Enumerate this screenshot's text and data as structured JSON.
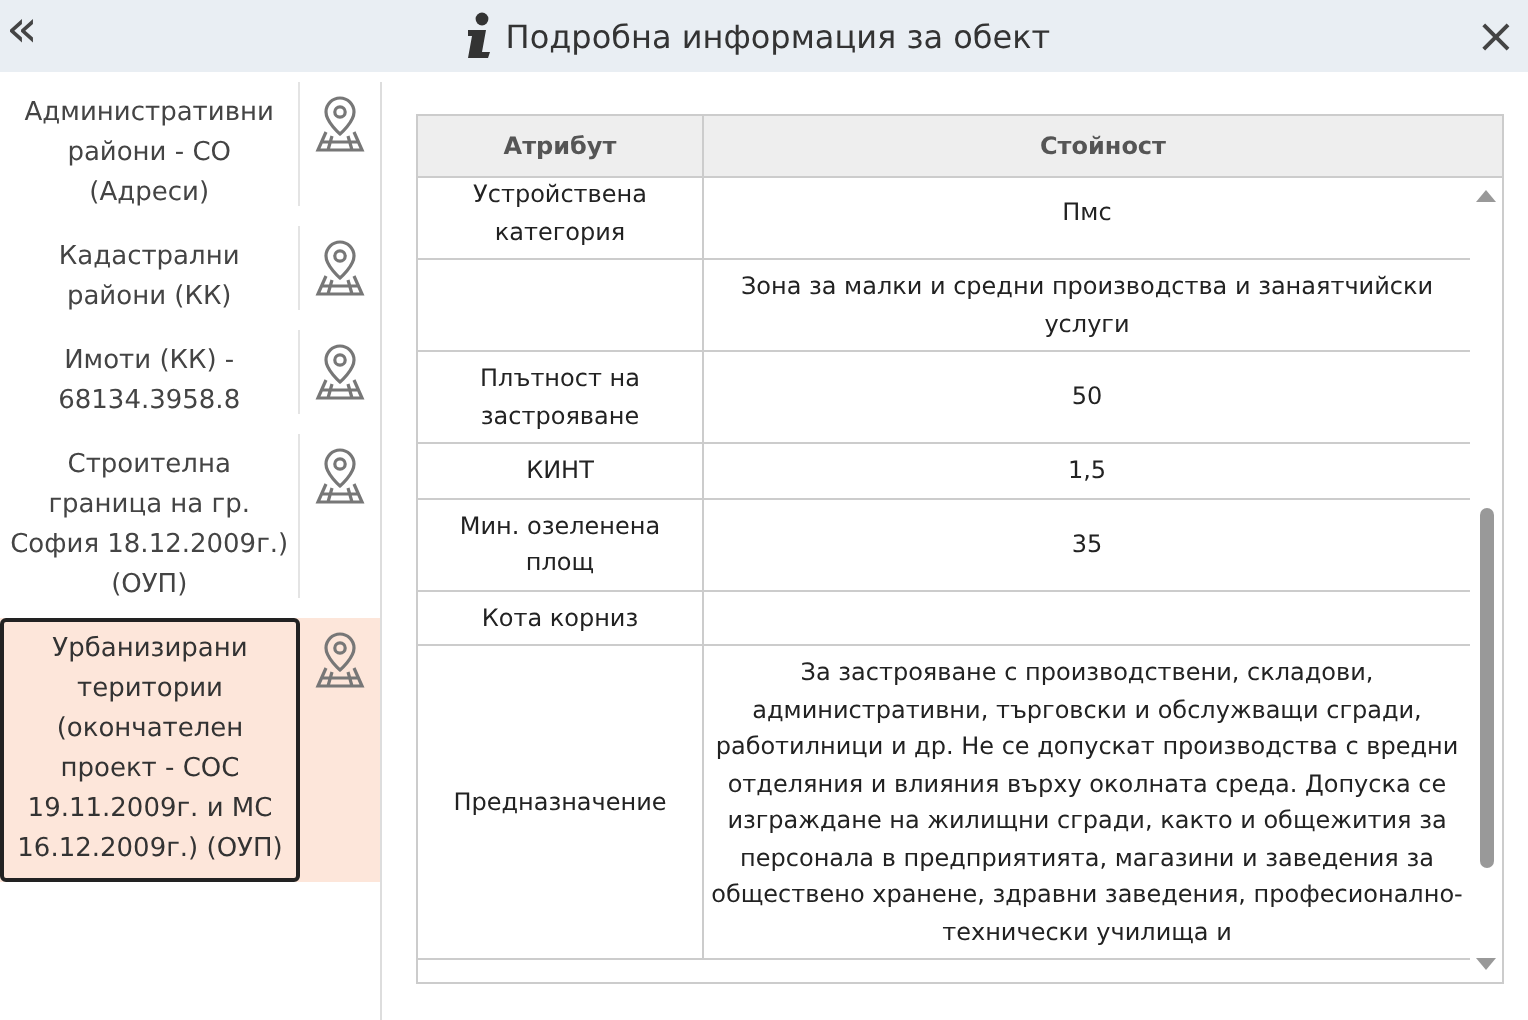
{
  "header": {
    "collapse_glyph": "«",
    "title": "Подробна информация за обект",
    "close_glyph": "×"
  },
  "layers": [
    {
      "label": "Административни райони - СО (Адреси)",
      "selected": false
    },
    {
      "label": "Кадастрални райони (КК)",
      "selected": false
    },
    {
      "label": "Имоти (КК) - 68134.3958.8",
      "selected": false
    },
    {
      "label": "Строителна граница на гр. София 18.12.2009г.) (ОУП)",
      "selected": false
    },
    {
      "label": "Урбанизирани територии (окончателен проект - СОС 19.11.2009г. и МС 16.12.2009г.) (ОУП)",
      "selected": true
    }
  ],
  "table": {
    "columns": [
      "Атрибут",
      "Стойност"
    ],
    "rows": [
      {
        "attribute": "Устройствена категория",
        "value": "Пмс"
      },
      {
        "value": "Зона за малки и средни производства и занаятчийски услуги"
      },
      {
        "attribute": "Плътност на застрояване",
        "value": "50"
      },
      {
        "attribute": "КИНТ",
        "value": "1,5"
      },
      {
        "attribute": "Мин. озеленена площ",
        "value": "35"
      },
      {
        "attribute": "Кота корниз"
      },
      {
        "attribute": "Предназначение",
        "value": "За застрояване с производствени, складови, административни, търговски и обслужващи сгради, работилници и др. Не се допускат производства с вредни отделяния и влияния върху околната среда. Допуска се изграждане на жилищни сгради, както и общежития за персонала в предприятията, магазини и заведения за обществено хранене, здравни заведения, професионално-технически училища и"
      }
    ]
  }
}
